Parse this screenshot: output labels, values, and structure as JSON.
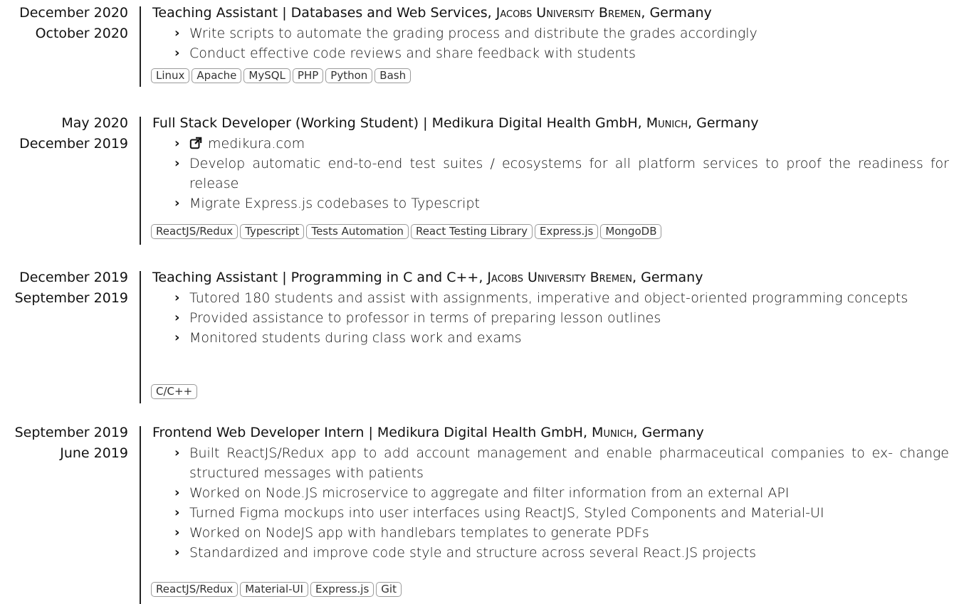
{
  "entries": [
    {
      "date_end": "December 2020",
      "date_start": "October 2020",
      "role": "Teaching Assistant",
      "course": "Databases and Web Services",
      "org": "Jacobs University Bremen",
      "country": "Germany",
      "bullets": [
        "Write scripts to automate the grading process and distribute the grades accordingly",
        "Conduct effective code reviews and share feedback with students"
      ],
      "tags": [
        "Linux",
        "Apache",
        "MySQL",
        "PHP",
        "Python",
        "Bash"
      ]
    },
    {
      "date_end": "May 2020",
      "date_start": "December 2019",
      "role": "Full Stack Developer (Working Student)",
      "company": "Medikura Digital Health GmbH",
      "city": "Munich",
      "country": "Germany",
      "link_text": "medikura.com",
      "link_icon": "external-link-icon",
      "bullets": [
        "Develop automatic end-to-end test suites / ecosystems for all platform services to proof the readiness for release",
        "Migrate Express.js codebases to Typescript"
      ],
      "tags": [
        "ReactJS/Redux",
        "Typescript",
        "Tests Automation",
        "React Testing Library",
        "Express.js",
        "MongoDB"
      ]
    },
    {
      "date_end": "December 2019",
      "date_start": "September 2019",
      "role": "Teaching Assistant",
      "course": "Programming in C and C++",
      "org": "Jacobs University Bremen",
      "country": "Germany",
      "bullets": [
        "Tutored 180 students and assist with assignments, imperative and object-oriented programming concepts",
        "Provided assistance to professor in terms of preparing lesson outlines",
        "Monitored students during class work and exams"
      ],
      "tags": [
        "C/C++"
      ]
    },
    {
      "date_end": "September 2019",
      "date_start": "June 2019",
      "role": "Frontend Web Developer Intern",
      "company": "Medikura Digital Health GmbH",
      "city": "Munich",
      "country": "Germany",
      "bullets": [
        "Built ReactJS/Redux app to add account management and enable pharmaceutical companies to ex- change structured messages with patients",
        "Worked on Node.JS microservice to aggregate and filter information from an external API",
        "Turned Figma mockups into user interfaces using ReactJS, Styled Components and Material-UI",
        "Worked on NodeJS app with handlebars templates to generate PDFs",
        "Standardized and improve code style and structure across several React.JS projects"
      ],
      "tags": [
        "ReactJS/Redux",
        "Material-UI",
        "Express.js",
        "Git"
      ]
    }
  ],
  "separators": {
    "pipe": " | ",
    "comma": ", ",
    "bullet_glyph": "›"
  }
}
